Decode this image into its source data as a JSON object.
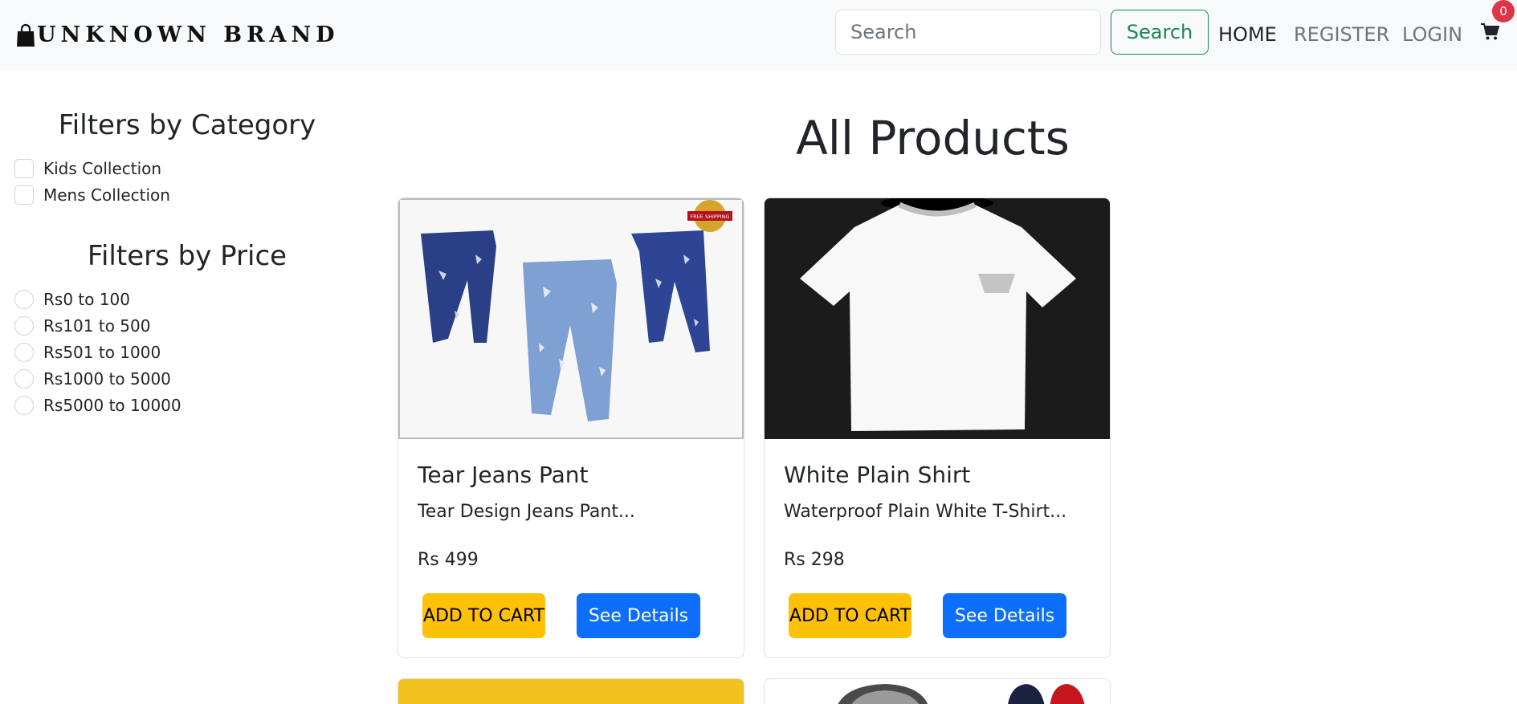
{
  "navbar": {
    "brand_text": "UNKNOWN BRAND",
    "search_placeholder": "Search",
    "search_button": "Search",
    "links": {
      "home": "HOME",
      "register": "REGISTER",
      "login": "LOGIN"
    },
    "cart_count": "0"
  },
  "sidebar": {
    "category_heading": "Filters by Category",
    "categories": [
      "Kids Collection",
      "Mens Collection"
    ],
    "price_heading": "Filters by Price",
    "prices": [
      "Rs0 to 100",
      "Rs101 to 500",
      "Rs501 to 1000",
      "Rs1000 to 5000",
      "Rs5000 to 10000"
    ]
  },
  "main": {
    "title": "All Products",
    "products": [
      {
        "name": "Tear Jeans Pant",
        "description": "Tear Design Jeans Pant...",
        "price": "Rs 499",
        "add_to_cart": "ADD TO CART",
        "details": "See Details",
        "badge_text": "FREE SHIPPING"
      },
      {
        "name": "White Plain Shirt",
        "description": "Waterproof Plain White T-Shirt...",
        "price": "Rs 298",
        "add_to_cart": "ADD TO CART",
        "details": "See Details"
      }
    ]
  },
  "colors": {
    "navbar_bg": "#f8f9fa",
    "search_green": "#198754",
    "cart_yellow": "#ffc107",
    "details_blue": "#0d6efd",
    "badge_red": "#dc3545"
  }
}
